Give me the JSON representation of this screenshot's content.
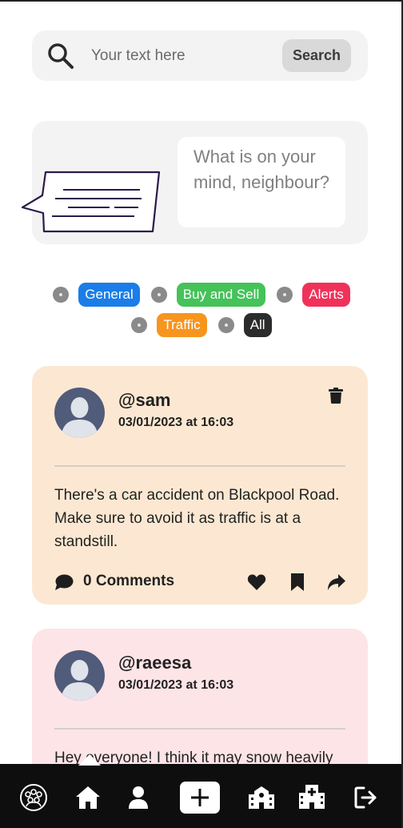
{
  "search": {
    "placeholder": "Your text here",
    "button_label": "Search",
    "icon": "search-icon"
  },
  "compose": {
    "prompt": "What is on your mind, neighbour?",
    "icon": "speech-bubble-icon"
  },
  "filters": [
    {
      "label": "General",
      "color": "#1a7de8"
    },
    {
      "label": "Buy and Sell",
      "color": "#45c25a"
    },
    {
      "label": "Alerts",
      "color": "#f0325a"
    },
    {
      "label": "Traffic",
      "color": "#f7951f"
    },
    {
      "label": "All",
      "color": "#2c2c2c"
    }
  ],
  "posts": [
    {
      "handle": "@sam",
      "timestamp": "03/01/2023 at 16:03",
      "text": "There's a car accident on Blackpool Road. Make sure to avoid it as traffic is at a standstill.",
      "comments_label": "0 Comments",
      "background": "#fce8d2"
    },
    {
      "handle": "@raeesa",
      "timestamp": "03/01/2023 at 16:03",
      "text": "Hey everyone! I think it may snow heavily",
      "background": "#fde4e7"
    }
  ],
  "nav": {
    "items": [
      "community-icon",
      "home-icon",
      "profile-icon",
      "add-icon",
      "school-icon",
      "hospital-icon",
      "logout-icon"
    ],
    "active": "home-icon"
  },
  "colors": {
    "avatar_bg": "#515b7a",
    "avatar_fg": "#dfe3ea",
    "nav_bg": "#0e0e0e"
  }
}
